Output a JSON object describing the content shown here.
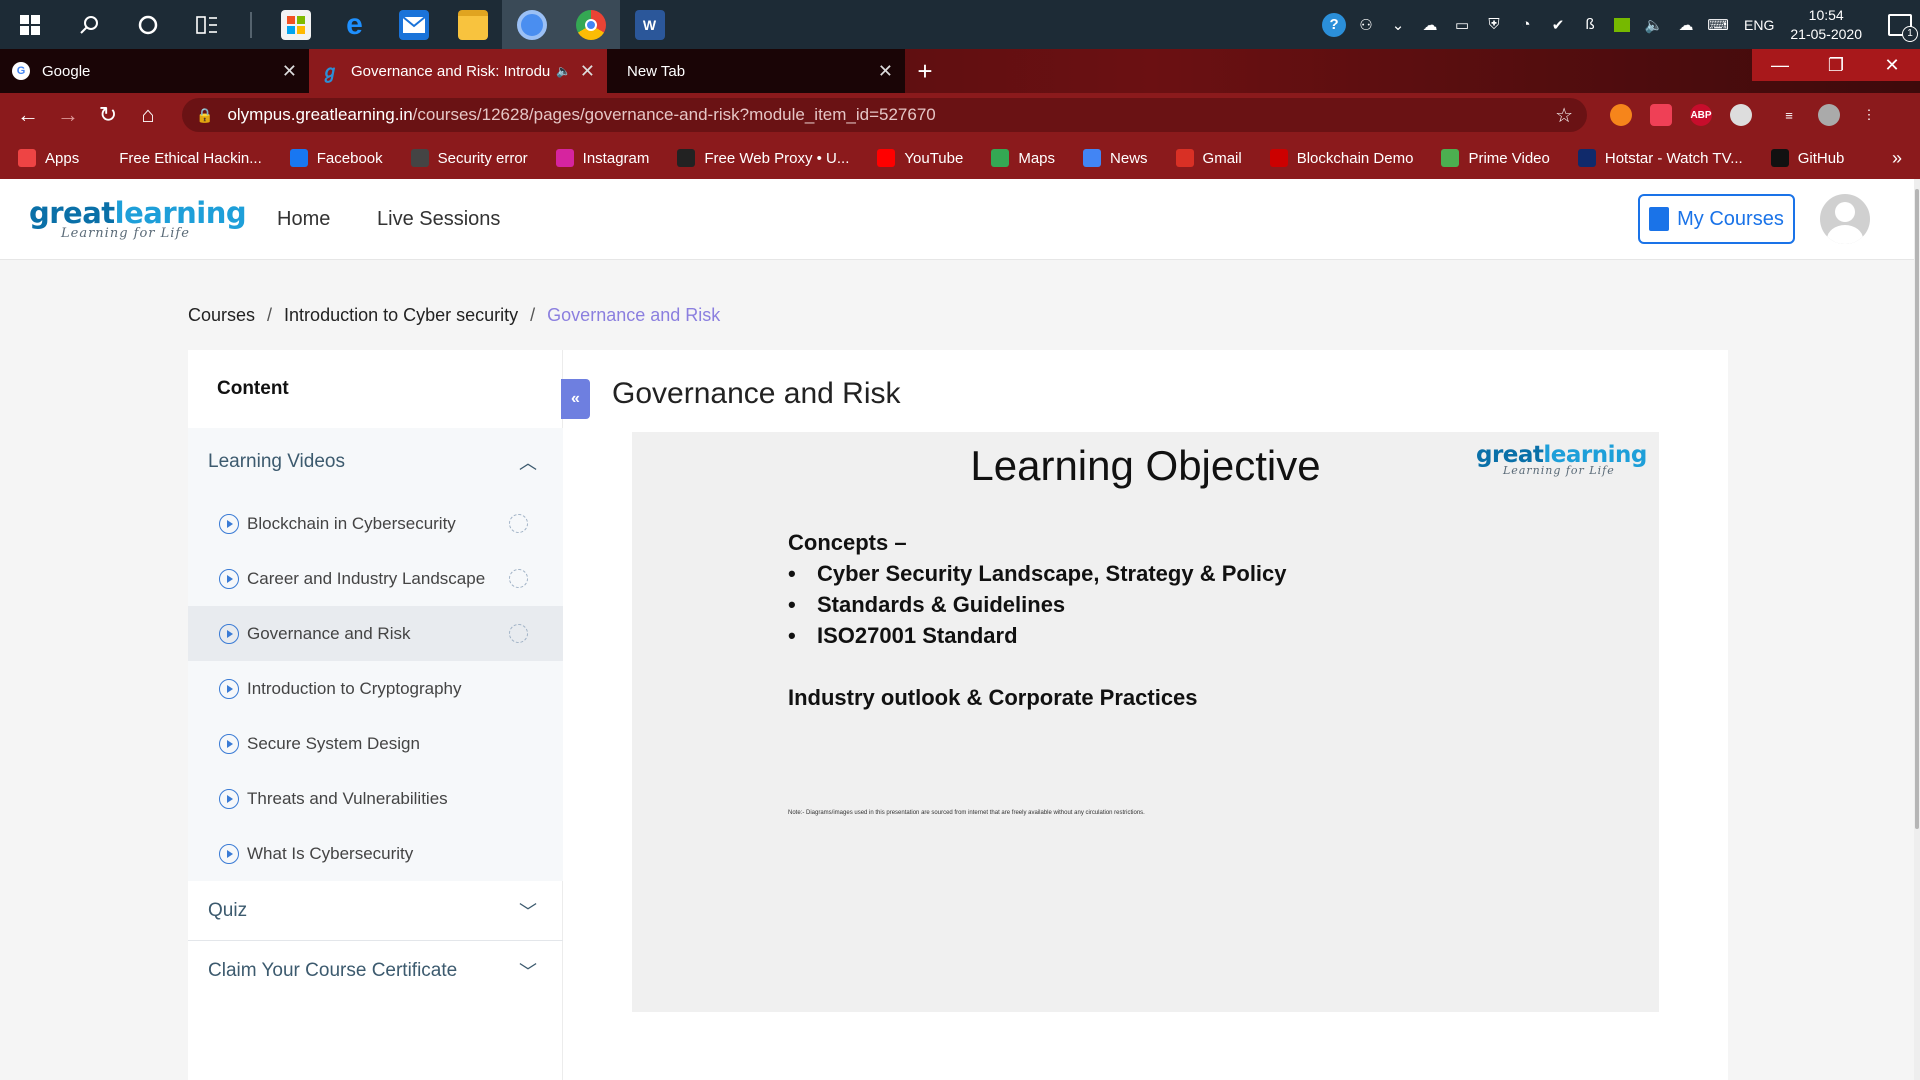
{
  "taskbar": {
    "icons": [
      "windows-logo",
      "search-icon",
      "cortana-icon",
      "task-view-icon"
    ],
    "apps": [
      "microsoft-store-icon",
      "edge-icon",
      "mail-icon",
      "file-explorer-icon",
      "chromium-icon",
      "chrome-icon",
      "word-icon"
    ],
    "tray": {
      "language": "ENG",
      "time": "10:54",
      "date": "21-05-2020",
      "notification_count": "1"
    }
  },
  "browser": {
    "tabs": [
      {
        "title": "Google",
        "active": false
      },
      {
        "title": "Governance and Risk: Introdu",
        "active": true
      },
      {
        "title": "New Tab",
        "active": false
      }
    ],
    "url_host": "olympus.greatlearning.in",
    "url_path": "/courses/12628/pages/governance-and-risk?module_item_id=527670",
    "extensions": [
      "metamask-icon",
      "pocket-icon",
      "ABP",
      "extension-icon"
    ],
    "bookmarks": [
      {
        "label": "Apps",
        "icon": "apps-grid-icon",
        "color": "#e44"
      },
      {
        "label": "Free Ethical Hackin...",
        "icon": "none",
        "color": ""
      },
      {
        "label": "Facebook",
        "icon": "facebook-icon",
        "color": "#1877f2"
      },
      {
        "label": "Security error",
        "icon": "globe-icon",
        "color": "#444"
      },
      {
        "label": "Instagram",
        "icon": "instagram-icon",
        "color": "#d6249f"
      },
      {
        "label": "Free Web Proxy • U...",
        "icon": "proxy-icon",
        "color": "#222"
      },
      {
        "label": "YouTube",
        "icon": "youtube-icon",
        "color": "#ff0000"
      },
      {
        "label": "Maps",
        "icon": "maps-icon",
        "color": "#34a853"
      },
      {
        "label": "News",
        "icon": "news-icon",
        "color": "#4285f4"
      },
      {
        "label": "Gmail",
        "icon": "gmail-icon",
        "color": "#d93025"
      },
      {
        "label": "Blockchain Demo",
        "icon": "blockchain-icon",
        "color": "#c00"
      },
      {
        "label": "Prime Video",
        "icon": "prime-video-icon",
        "color": "#4caf50"
      },
      {
        "label": "Hotstar - Watch TV...",
        "icon": "hotstar-icon",
        "color": "#102a6b"
      },
      {
        "label": "GitHub",
        "icon": "github-icon",
        "color": "#111"
      }
    ]
  },
  "site": {
    "logo_main": "great",
    "logo_accent": "learning",
    "logo_tagline": "Learning for Life",
    "nav": [
      "Home",
      "Live Sessions"
    ],
    "my_courses": "My Courses"
  },
  "breadcrumb": [
    "Courses",
    "Introduction to Cyber security",
    "Governance and Risk"
  ],
  "sidebar": {
    "title": "Content",
    "section": "Learning Videos",
    "videos": [
      {
        "label": "Blockchain in Cybersecurity",
        "progress": true
      },
      {
        "label": "Career and Industry Landscape",
        "progress": true
      },
      {
        "label": "Governance and Risk",
        "progress": true,
        "selected": true
      },
      {
        "label": "Introduction to Cryptography",
        "progress": false
      },
      {
        "label": "Secure System Design",
        "progress": false
      },
      {
        "label": "Threats and Vulnerabilities",
        "progress": false
      },
      {
        "label": "What Is Cybersecurity",
        "progress": false
      }
    ],
    "quiz": "Quiz",
    "certificate": "Claim Your Course Certificate"
  },
  "lesson": {
    "title": "Governance and Risk",
    "collapse_glyph": "«",
    "slide": {
      "title": "Learning Objective",
      "logo_main": "great",
      "logo_accent": "learning",
      "logo_tagline": "Learning for Life",
      "concepts_heading": "Concepts –",
      "bullets": [
        "Cyber Security Landscape, Strategy & Policy",
        "Standards & Guidelines",
        "ISO27001 Standard"
      ],
      "extra": "Industry outlook & Corporate Practices",
      "note": "Note:- Diagrams/images used in this presentation are sourced from internet that are freely available without any circulation restrictions."
    }
  }
}
